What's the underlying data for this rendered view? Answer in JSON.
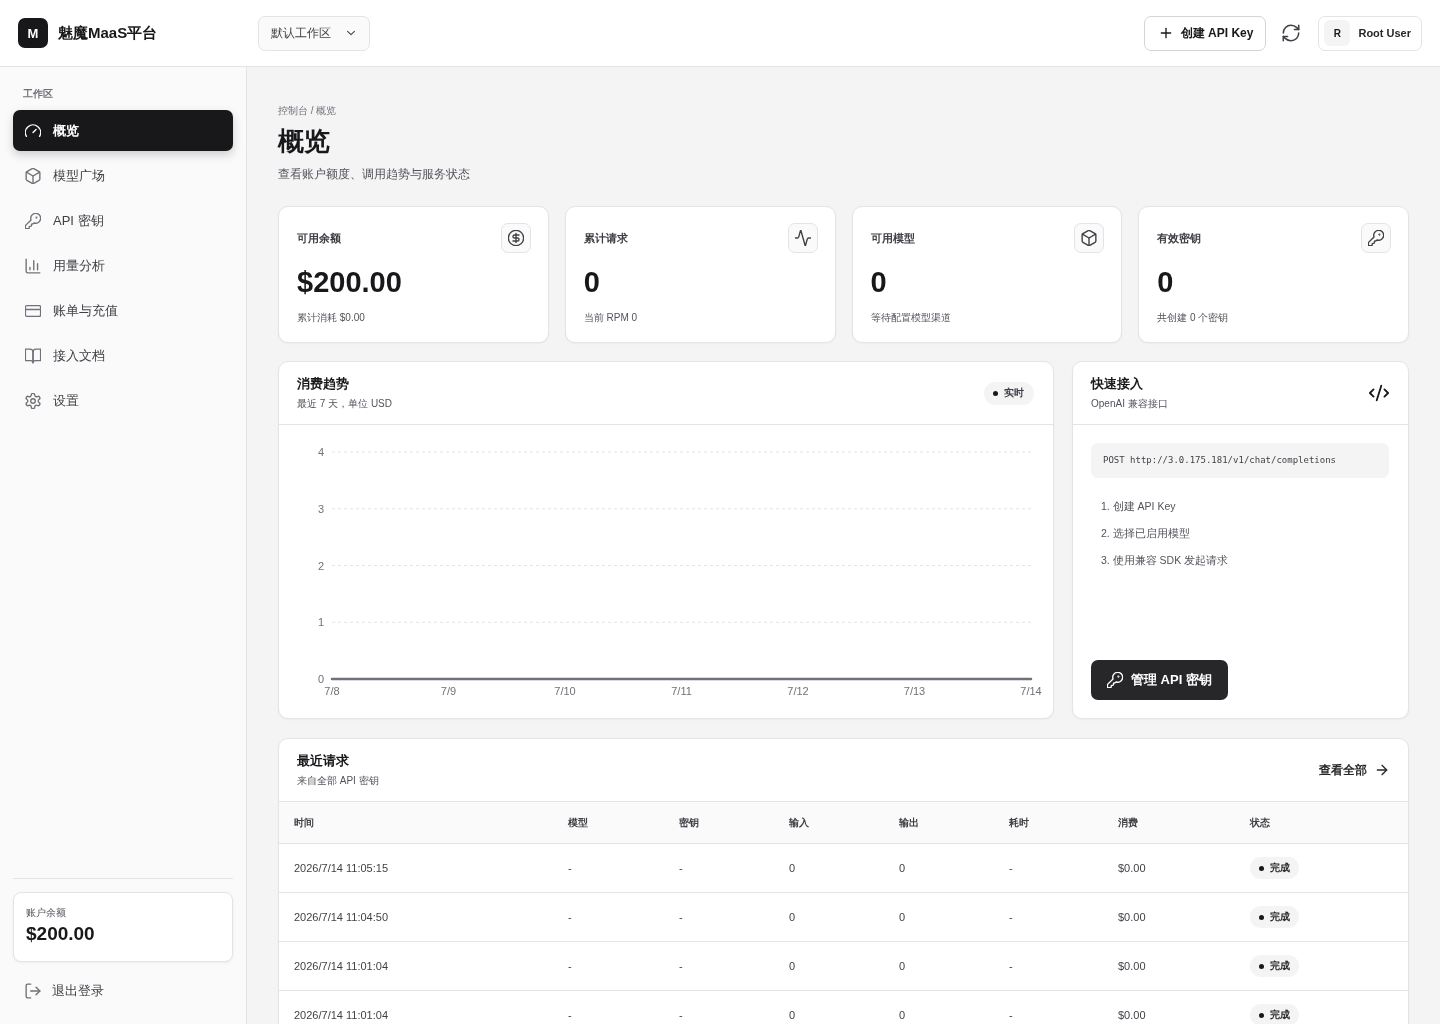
{
  "header": {
    "logo": "M",
    "brand": "魅魔MaaS平台",
    "workspace_select": {
      "value": "默认工作区"
    },
    "create_button": "创建 API Key",
    "user": {
      "avatar": "R",
      "name": "Root User"
    }
  },
  "sidebar": {
    "section_label": "工作区",
    "items": [
      {
        "label": "概览",
        "selected": true
      },
      {
        "label": "模型广场",
        "selected": false
      },
      {
        "label": "API 密钥",
        "selected": false
      },
      {
        "label": "用量分析",
        "selected": false
      },
      {
        "label": "账单与充值",
        "selected": false
      },
      {
        "label": "接入文档",
        "selected": false
      },
      {
        "label": "设置",
        "selected": false
      }
    ],
    "balance": {
      "label": "账户余额",
      "value": "$200.00"
    },
    "logout": "退出登录"
  },
  "page": {
    "breadcrumb": "控制台 / 概览",
    "title": "概览",
    "subtitle": "查看账户额度、调用趋势与服务状态"
  },
  "stats": [
    {
      "label": "可用余额",
      "value": "$200.00",
      "note": "累计消耗 $0.00"
    },
    {
      "label": "累计请求",
      "value": "0",
      "note": "当前 RPM 0"
    },
    {
      "label": "可用模型",
      "value": "0",
      "note": "等待配置模型渠道"
    },
    {
      "label": "有效密钥",
      "value": "0",
      "note": "共创建 0 个密钥"
    }
  ],
  "trend": {
    "title": "消费趋势",
    "subtitle": "最近 7 天，单位 USD",
    "badge": "实时",
    "chart_data": {
      "type": "line",
      "categories": [
        "7/8",
        "7/9",
        "7/10",
        "7/11",
        "7/12",
        "7/13",
        "7/14"
      ],
      "series": [
        {
          "color": "#71717a",
          "values": [
            0,
            0,
            0,
            0,
            0,
            0,
            0
          ]
        }
      ],
      "ylim": [
        0,
        4
      ],
      "yticks": [
        0,
        1,
        2,
        3,
        4
      ],
      "grid": true
    }
  },
  "quick_start": {
    "title": "快速接入",
    "subtitle": "OpenAI 兼容接口",
    "endpoint": "POST http://3.0.175.181/v1/chat/completions",
    "steps": [
      "1. 创建 API Key",
      "2. 选择已启用模型",
      "3. 使用兼容 SDK 发起请求"
    ],
    "button": "管理 API 密钥"
  },
  "recent_requests": {
    "title": "最近请求",
    "subtitle": "来自全部 API 密钥",
    "view_all": "查看全部",
    "columns": [
      {
        "label": "时间",
        "kind": "text"
      },
      {
        "label": "模型",
        "kind": "text"
      },
      {
        "label": "密钥",
        "kind": "text"
      },
      {
        "label": "输入",
        "kind": "text"
      },
      {
        "label": "输出",
        "kind": "text"
      },
      {
        "label": "耗时",
        "kind": "text"
      },
      {
        "label": "消费",
        "kind": "text"
      },
      {
        "label": "状态",
        "kind": "status"
      }
    ],
    "rows": [
      [
        "2026/7/14 11:05:15",
        "-",
        "-",
        "0",
        "0",
        "-",
        "$0.00",
        "完成"
      ],
      [
        "2026/7/14 11:04:50",
        "-",
        "-",
        "0",
        "0",
        "-",
        "$0.00",
        "完成"
      ],
      [
        "2026/7/14 11:01:04",
        "-",
        "-",
        "0",
        "0",
        "-",
        "$0.00",
        "完成"
      ],
      [
        "2026/7/14 11:01:04",
        "-",
        "-",
        "0",
        "0",
        "-",
        "$0.00",
        "完成"
      ]
    ]
  }
}
